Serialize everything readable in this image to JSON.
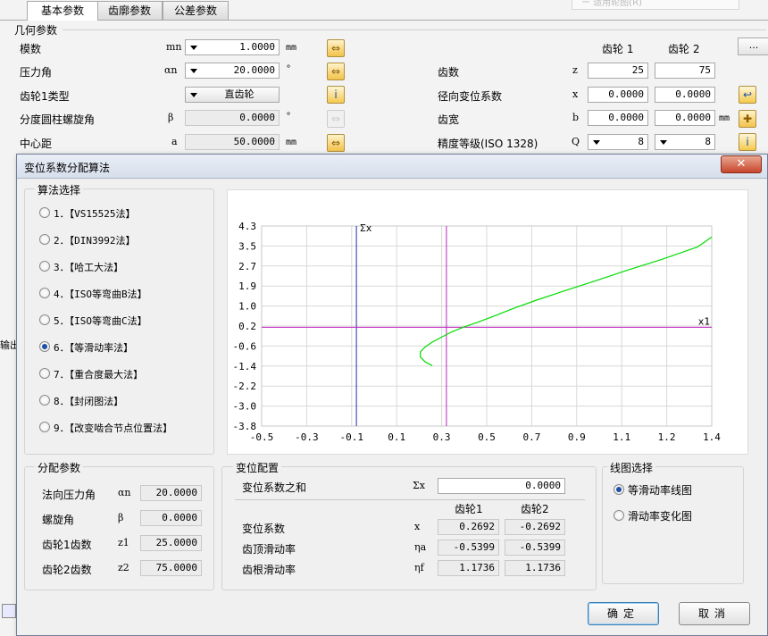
{
  "tabs": [
    "基本参数",
    "齿廓参数",
    "公差参数"
  ],
  "top_right_text": "ー 适用轮图(R)",
  "geometry": {
    "title": "几何参数",
    "module": {
      "label": "模数",
      "symbol": "mn",
      "value": "1.0000",
      "unit": "mm"
    },
    "pressure_angle": {
      "label": "压力角",
      "symbol": "αn",
      "value": "20.0000",
      "unit": "°"
    },
    "gear1_type": {
      "label": "齿轮1类型",
      "value": "直齿轮"
    },
    "helix_angle": {
      "label": "分度圆柱螺旋角",
      "symbol": "β",
      "value": "0.0000",
      "unit": "°"
    },
    "center_distance": {
      "label": "中心距",
      "symbol": "a",
      "value": "50.0000",
      "unit": "mm"
    },
    "col_gear1": "齿轮 1",
    "col_gear2": "齿轮 2",
    "more_button": "...",
    "teeth": {
      "label": "齿数",
      "symbol": "z",
      "gear1": "25",
      "gear2": "75"
    },
    "shift_coef": {
      "label": "径向变位系数",
      "symbol": "x",
      "gear1": "0.0000",
      "gear2": "0.0000"
    },
    "face_width": {
      "label": "齿宽",
      "symbol": "b",
      "gear1": "0.0000",
      "gear2": "0.0000",
      "unit": "mm"
    },
    "accuracy": {
      "label": "精度等级(ISO 1328)",
      "symbol": "Q",
      "gear1": "8",
      "gear2": "8"
    }
  },
  "side_label": "输出",
  "dialog": {
    "title": "变位系数分配算法",
    "close": "✕",
    "algo_title": "算法选择",
    "algorithms": [
      {
        "label": "1．【VS15525法】",
        "selected": false
      },
      {
        "label": "2．【DIN3992法】",
        "selected": false
      },
      {
        "label": "3．【哈工大法】",
        "selected": false
      },
      {
        "label": "4．【ISO等弯曲B法】",
        "selected": false
      },
      {
        "label": "5．【ISO等弯曲C法】",
        "selected": false
      },
      {
        "label": "6．【等滑动率法】",
        "selected": true
      },
      {
        "label": "7．【重合度最大法】",
        "selected": false
      },
      {
        "label": "8．【封闭图法】",
        "selected": false
      },
      {
        "label": "9．【改变啮合节点位置法】",
        "selected": false
      }
    ],
    "params_title": "分配参数",
    "params": [
      {
        "label": "法向压力角",
        "symbol": "αn",
        "value": "20.0000"
      },
      {
        "label": "螺旋角",
        "symbol": "β",
        "value": "0.0000"
      },
      {
        "label": "齿轮1齿数",
        "symbol": "z1",
        "value": "25.0000"
      },
      {
        "label": "齿轮2齿数",
        "symbol": "z2",
        "value": "75.0000"
      }
    ],
    "shift_title": "变位配置",
    "shift_sum": {
      "label": "变位系数之和",
      "symbol": "Σx",
      "value": "0.0000"
    },
    "col_gear1": "齿轮1",
    "col_gear2": "齿轮2",
    "shift_rows": [
      {
        "label": "变位系数",
        "symbol": "x",
        "gear1": "0.2692",
        "gear2": "-0.2692"
      },
      {
        "label": "齿顶滑动率",
        "symbol": "ηa",
        "gear1": "-0.5399",
        "gear2": "-0.5399"
      },
      {
        "label": "齿根滑动率",
        "symbol": "ηf",
        "gear1": "1.1736",
        "gear2": "1.1736"
      }
    ],
    "plot_select_title": "线图选择",
    "plot_options": [
      {
        "label": "等滑动率线图",
        "selected": true
      },
      {
        "label": "滑动率变化图",
        "selected": false
      }
    ],
    "ok": "确定",
    "cancel": "取消"
  },
  "chart_data": {
    "type": "line",
    "x_ticks": [
      "-0.5",
      "-0.3",
      "-0.1",
      "0.1",
      "0.3",
      "0.5",
      "0.7",
      "0.9",
      "1.1",
      "1.2",
      "1.4"
    ],
    "y_ticks": [
      "4.3",
      "3.5",
      "2.7",
      "1.9",
      "1.0",
      "0.2",
      "-0.6",
      "-1.4",
      "-2.2",
      "-3.0",
      "-3.8"
    ],
    "xlabel": "x1",
    "ylabel": "Σx",
    "series": [
      {
        "color": "#00dd00",
        "points": [
          [
            0.22,
            -1.35
          ],
          [
            0.19,
            -1.2
          ],
          [
            0.17,
            -1.0
          ],
          [
            0.17,
            -0.8
          ],
          [
            0.19,
            -0.6
          ],
          [
            0.22,
            -0.4
          ],
          [
            0.26,
            -0.2
          ],
          [
            0.3,
            0.0
          ],
          [
            0.35,
            0.2
          ],
          [
            0.41,
            0.4
          ],
          [
            0.48,
            0.65
          ],
          [
            0.56,
            0.95
          ],
          [
            0.66,
            1.3
          ],
          [
            0.77,
            1.65
          ],
          [
            0.9,
            2.05
          ],
          [
            1.04,
            2.5
          ],
          [
            1.19,
            2.95
          ],
          [
            1.34,
            3.45
          ],
          [
            1.4,
            3.85
          ]
        ]
      }
    ],
    "vlines": [
      {
        "x": -0.1,
        "color": "#1f2fa8"
      },
      {
        "x": 0.28,
        "color": "#c020c0"
      }
    ],
    "hlines": [
      {
        "y": 0.2,
        "color": "#c020c0"
      }
    ],
    "xlim": [
      -0.5,
      1.4
    ],
    "ylim": [
      -3.8,
      4.3
    ],
    "grid": true
  }
}
